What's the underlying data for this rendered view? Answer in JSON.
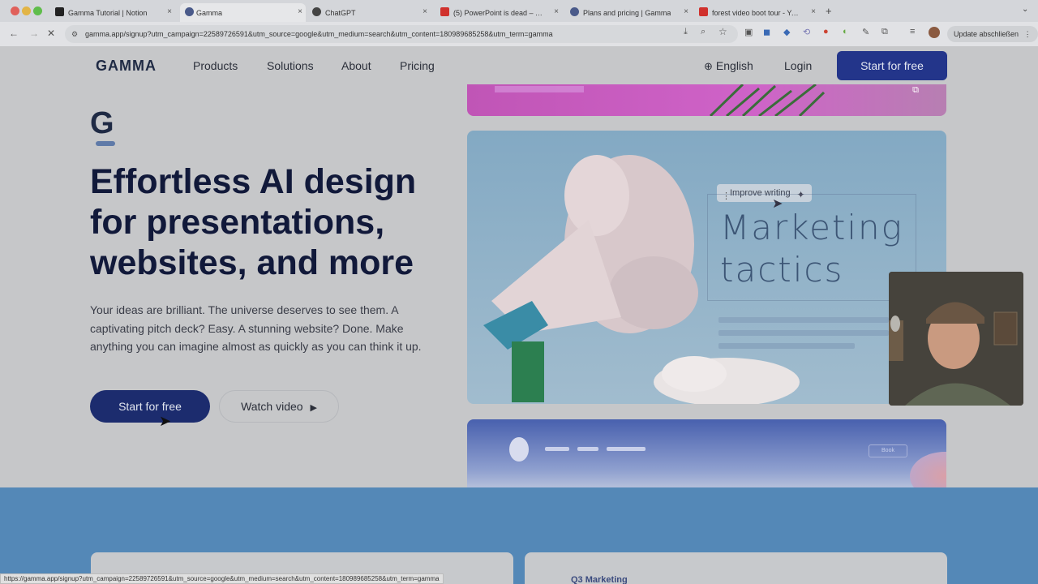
{
  "browser": {
    "tabs": [
      {
        "label": "Gamma Tutorial | Notion",
        "active": false,
        "favicon_color": "#222222"
      },
      {
        "label": "Gamma",
        "active": true,
        "favicon_color": "#4a5a8a"
      },
      {
        "label": "ChatGPT",
        "active": false,
        "favicon_color": "#444444"
      },
      {
        "label": "(5) PowerPoint is dead – Thi",
        "active": false,
        "favicon_color": "#d0312d"
      },
      {
        "label": "Plans and pricing | Gamma",
        "active": false,
        "favicon_color": "#4a5a8a"
      },
      {
        "label": "forest video boot tour - YouTu",
        "active": false,
        "favicon_color": "#d0312d"
      }
    ],
    "new_tab_icon": "plus-icon",
    "url": "gamma.app/signup?utm_campaign=22589726591&utm_source=google&utm_medium=search&utm_content=180989685258&utm_term=gamma",
    "update_button": "Update abschließen",
    "status_url": "https://gamma.app/signup?utm_campaign=22589726591&utm_source=google&utm_medium=search&utm_content=180989685258&utm_term=gamma"
  },
  "nav": {
    "logo": "GAMMA",
    "links": [
      "Products",
      "Solutions",
      "About",
      "Pricing"
    ],
    "language": "English",
    "login": "Login",
    "cta": "Start for free"
  },
  "hero": {
    "logo_mark": "G",
    "headline": "Effortless AI design for presentations, websites, and more",
    "subtext": "Your ideas are brilliant. The universe deserves to see them. A captivating pitch deck? Easy. A stunning website? Done. Make anything you can imagine almost as quickly as you can think it up.",
    "primary_cta": "Start for free",
    "secondary_cta": "Watch video"
  },
  "preview": {
    "improve_label": "Improve writing",
    "marketing_line1": "Marketing",
    "marketing_line2": "tactics",
    "book_label": "Book"
  },
  "lower": {
    "card_label": "Q3 Marketing"
  },
  "colors": {
    "accent": "#23358a",
    "band": "#5488b7"
  }
}
